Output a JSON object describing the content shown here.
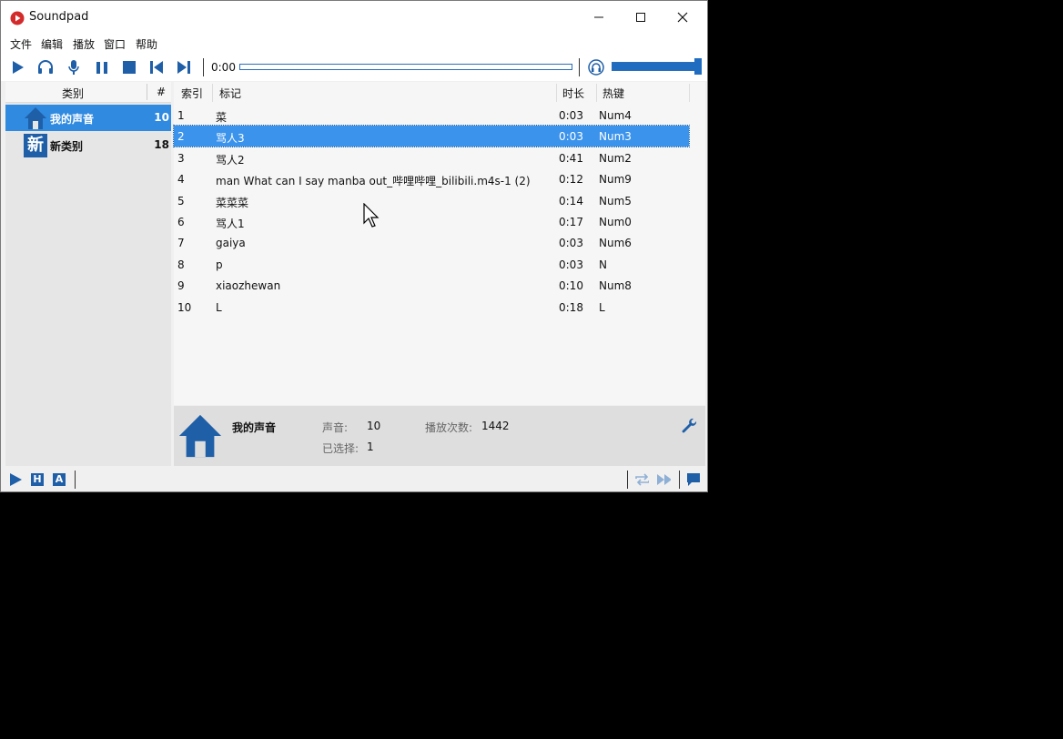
{
  "window": {
    "title": "Soundpad",
    "accent": "#2f8ae0",
    "icon_blue": "#1f5fa8"
  },
  "menu": [
    "文件",
    "编辑",
    "播放",
    "窗口",
    "帮助"
  ],
  "toolbar": {
    "time": "0:00",
    "progress": 0.0,
    "volume": 0.98,
    "icons": [
      "play-icon",
      "headphones-icon",
      "microphone-icon",
      "pause-icon",
      "stop-icon",
      "previous-icon",
      "next-icon",
      "headphones-toggle-icon"
    ]
  },
  "categories": {
    "header_name": "类别",
    "header_count": "#",
    "items": [
      {
        "name": "我的声音",
        "count": "10",
        "icon": "home-icon"
      },
      {
        "name": "新类别",
        "count": "18",
        "icon": "new-category-icon",
        "icon_text": "新"
      }
    ]
  },
  "sounds": {
    "headers": {
      "index": "索引",
      "tag": "标记",
      "duration": "时长",
      "hotkey": "热键"
    },
    "rows": [
      {
        "index": "1",
        "tag": "菜",
        "duration": "0:03",
        "hotkey": "Num4"
      },
      {
        "index": "2",
        "tag": "骂人3",
        "duration": "0:03",
        "hotkey": "Num3"
      },
      {
        "index": "3",
        "tag": "骂人2",
        "duration": "0:41",
        "hotkey": "Num2"
      },
      {
        "index": "4",
        "tag": "man What can I say manba out_哔哩哔哩_bilibili.m4s-1 (2)",
        "duration": "0:12",
        "hotkey": "Num9"
      },
      {
        "index": "5",
        "tag": "菜菜菜",
        "duration": "0:14",
        "hotkey": "Num5"
      },
      {
        "index": "6",
        "tag": "骂人1",
        "duration": "0:17",
        "hotkey": "Num0"
      },
      {
        "index": "7",
        "tag": "gaiya",
        "duration": "0:03",
        "hotkey": "Num6"
      },
      {
        "index": "8",
        "tag": "p",
        "duration": "0:03",
        "hotkey": "N"
      },
      {
        "index": "9",
        "tag": "xiaozhewan",
        "duration": "0:10",
        "hotkey": "Num8"
      },
      {
        "index": "10",
        "tag": "L",
        "duration": "0:18",
        "hotkey": "L"
      }
    ],
    "selected_index": 1
  },
  "info": {
    "category_name": "我的声音",
    "sounds_label": "声音:",
    "sounds_value": "10",
    "play_count_label": "播放次数:",
    "play_count_value": "1442",
    "selected_label": "已选择:",
    "selected_value": "1"
  },
  "statusbar": {
    "h_label": "H",
    "a_label": "A"
  }
}
